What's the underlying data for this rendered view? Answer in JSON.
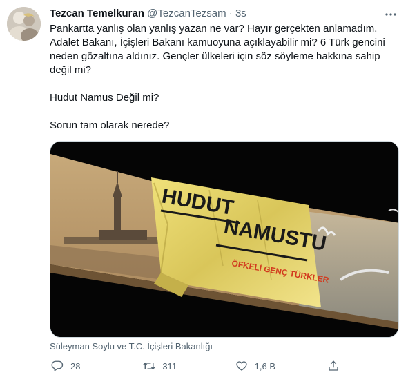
{
  "tweet": {
    "author_name": "Tezcan Temelkuran",
    "handle": "@TezcanTezsam",
    "separator": "·",
    "time": "3s",
    "paragraphs": [
      "Pankartta yanlış olan yanlış yazan ne var? Hayır gerçekten anlamadım. Adalet Bakanı, İçişleri Bakanı kamuoyuna açıklayabilir mi? 6 Türk gencini neden gözaltına aldınız. Gençler ülkeleri için söz söyleme hakkına sahip değil mi?",
      "Hudut Namus Değil mi?",
      "Sorun tam olarak nerede?"
    ],
    "media": {
      "banner_line1": "HUDUT",
      "banner_line2": "NAMUSTU",
      "banner_signature": "ÖFKELİ GENÇ TÜRKLER"
    },
    "tags": "Süleyman Soylu ve T.C. İçişleri Bakanlığı",
    "actions": {
      "reply_count": "28",
      "retweet_count": "311",
      "like_count": "1,6 B"
    }
  },
  "icons": {
    "more": "more-horizontal-icon",
    "reply": "reply-icon",
    "retweet": "retweet-icon",
    "like": "heart-icon",
    "share": "share-icon"
  },
  "colors": {
    "text": "#0f1419",
    "secondary": "#536471",
    "border": "#cfd9de",
    "banner_yellow": "#e8d86a"
  }
}
